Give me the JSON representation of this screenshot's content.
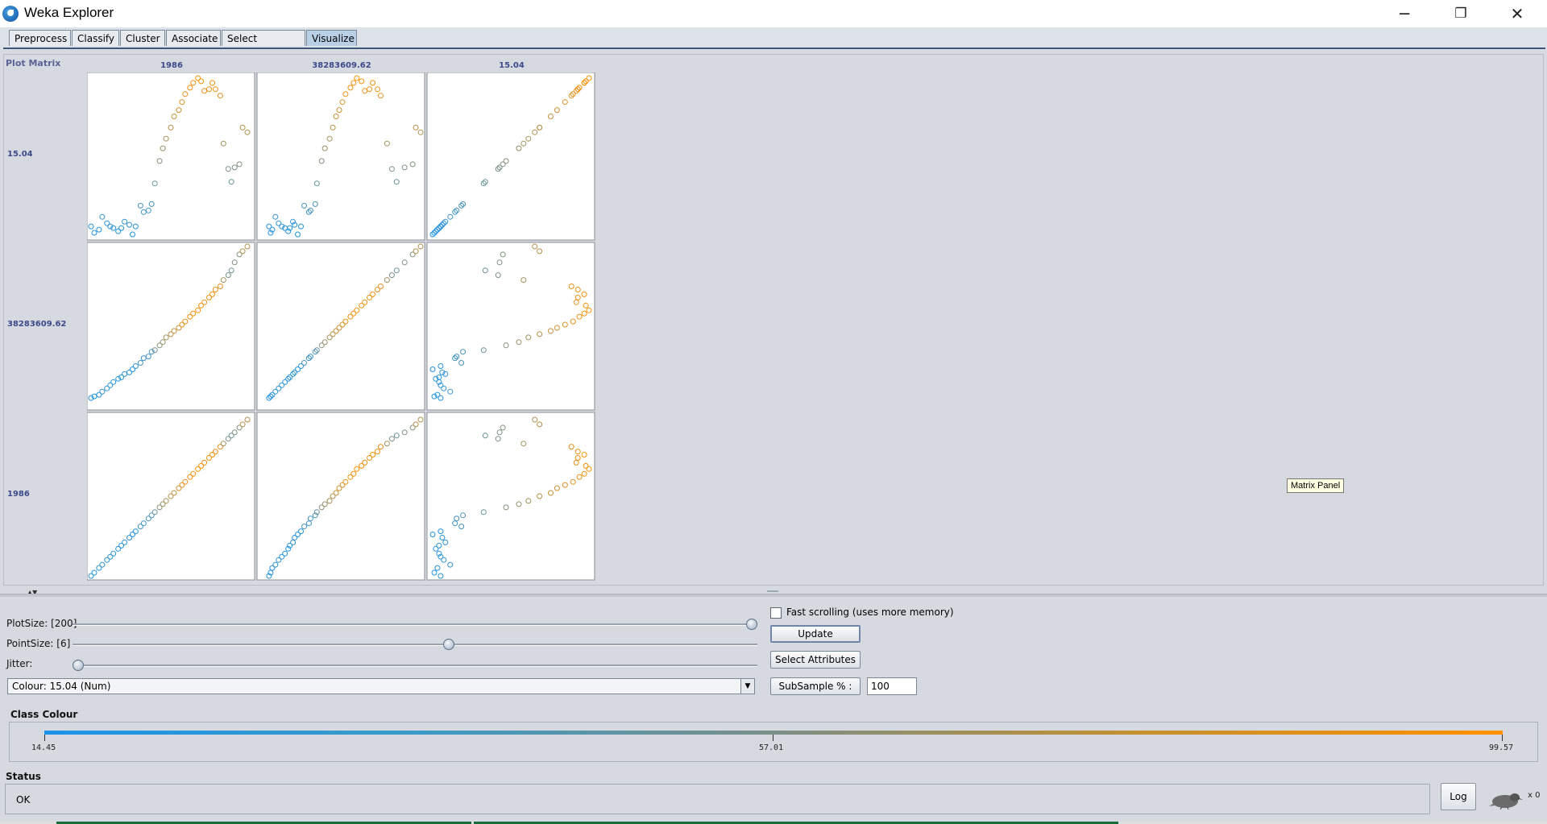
{
  "window": {
    "title": "Weka Explorer",
    "controls": {
      "minimize": "─",
      "restore": "❐",
      "close": "✕"
    }
  },
  "tabs": [
    {
      "label": "Preprocess"
    },
    {
      "label": "Classify"
    },
    {
      "label": "Cluster"
    },
    {
      "label": "Associate"
    },
    {
      "label": "Select attributes"
    },
    {
      "label": "Visualize",
      "active": true
    }
  ],
  "plot_matrix": {
    "title": "Plot Matrix",
    "column_labels": [
      "1986",
      "38283609.62",
      "15.04"
    ],
    "row_labels": [
      "15.04",
      "38283609.62",
      "1986"
    ],
    "tooltip": "Matrix Panel"
  },
  "chart_data": {
    "type": "scatter",
    "description_free": true,
    "attributes": [
      "1986",
      "38283609.62",
      "15.04"
    ],
    "colour_attribute": "15.04",
    "colour_range": [
      14.45,
      99.57
    ],
    "colour_mid": 57.01,
    "colours": {
      "low": "#1b93e8",
      "high": "#ff9000"
    },
    "point_marker": "open-circle",
    "year_points": [
      {
        "n": 0.0,
        "y": 0.05,
        "c": 0.06
      },
      {
        "n": 0.02,
        "y": 0.06,
        "c": 0.02
      },
      {
        "n": 0.05,
        "y": 0.07,
        "c": 0.04
      },
      {
        "n": 0.07,
        "y": 0.09,
        "c": 0.12
      },
      {
        "n": 0.1,
        "y": 0.11,
        "c": 0.08
      },
      {
        "n": 0.12,
        "y": 0.13,
        "c": 0.06
      },
      {
        "n": 0.14,
        "y": 0.15,
        "c": 0.05
      },
      {
        "n": 0.17,
        "y": 0.17,
        "c": 0.03
      },
      {
        "n": 0.19,
        "y": 0.18,
        "c": 0.05
      },
      {
        "n": 0.21,
        "y": 0.2,
        "c": 0.09
      },
      {
        "n": 0.24,
        "y": 0.21,
        "c": 0.07
      },
      {
        "n": 0.26,
        "y": 0.23,
        "c": 0.01
      },
      {
        "n": 0.28,
        "y": 0.25,
        "c": 0.06
      },
      {
        "n": 0.31,
        "y": 0.27,
        "c": 0.19
      },
      {
        "n": 0.33,
        "y": 0.3,
        "c": 0.15
      },
      {
        "n": 0.36,
        "y": 0.31,
        "c": 0.16
      },
      {
        "n": 0.38,
        "y": 0.34,
        "c": 0.2
      },
      {
        "n": 0.4,
        "y": 0.35,
        "c": 0.33
      },
      {
        "n": 0.43,
        "y": 0.38,
        "c": 0.47
      },
      {
        "n": 0.45,
        "y": 0.4,
        "c": 0.55
      },
      {
        "n": 0.47,
        "y": 0.43,
        "c": 0.61
      },
      {
        "n": 0.5,
        "y": 0.45,
        "c": 0.68
      },
      {
        "n": 0.52,
        "y": 0.47,
        "c": 0.75
      },
      {
        "n": 0.55,
        "y": 0.49,
        "c": 0.79
      },
      {
        "n": 0.57,
        "y": 0.51,
        "c": 0.84
      },
      {
        "n": 0.59,
        "y": 0.53,
        "c": 0.89
      },
      {
        "n": 0.62,
        "y": 0.56,
        "c": 0.93
      },
      {
        "n": 0.64,
        "y": 0.58,
        "c": 0.96
      },
      {
        "n": 0.67,
        "y": 0.6,
        "c": 0.99
      },
      {
        "n": 0.69,
        "y": 0.63,
        "c": 0.97
      },
      {
        "n": 0.71,
        "y": 0.65,
        "c": 0.91
      },
      {
        "n": 0.74,
        "y": 0.68,
        "c": 0.92
      },
      {
        "n": 0.76,
        "y": 0.7,
        "c": 0.96
      },
      {
        "n": 0.78,
        "y": 0.73,
        "c": 0.92
      },
      {
        "n": 0.81,
        "y": 0.75,
        "c": 0.88
      },
      {
        "n": 0.83,
        "y": 0.79,
        "c": 0.58
      },
      {
        "n": 0.86,
        "y": 0.82,
        "c": 0.42
      },
      {
        "n": 0.88,
        "y": 0.85,
        "c": 0.34
      },
      {
        "n": 0.9,
        "y": 0.9,
        "c": 0.43
      },
      {
        "n": 0.93,
        "y": 0.95,
        "c": 0.45
      },
      {
        "n": 0.95,
        "y": 0.97,
        "c": 0.68
      },
      {
        "n": 0.98,
        "y": 1.0,
        "c": 0.65
      }
    ]
  },
  "controls": {
    "plot_size": {
      "label": "PlotSize: [200]",
      "value_fraction": 1.0
    },
    "point_size": {
      "label": "PointSize: [6]",
      "value_fraction": 0.55
    },
    "jitter": {
      "label": "Jitter:",
      "value_fraction": 0.0
    },
    "colour_combo": "Colour: 15.04  (Num)",
    "fast_scrolling": {
      "label": "Fast scrolling (uses more memory)",
      "checked": false
    },
    "update_button": "Update",
    "select_attributes_button": "Select Attributes",
    "subsample_button": "SubSample % :",
    "subsample_value": "100"
  },
  "class_colour": {
    "title": "Class Colour",
    "min_label": "14.45",
    "mid_label": "57.01",
    "max_label": "99.57"
  },
  "status": {
    "title": "Status",
    "text": "OK",
    "log_button": "Log",
    "task_count": "x 0"
  }
}
